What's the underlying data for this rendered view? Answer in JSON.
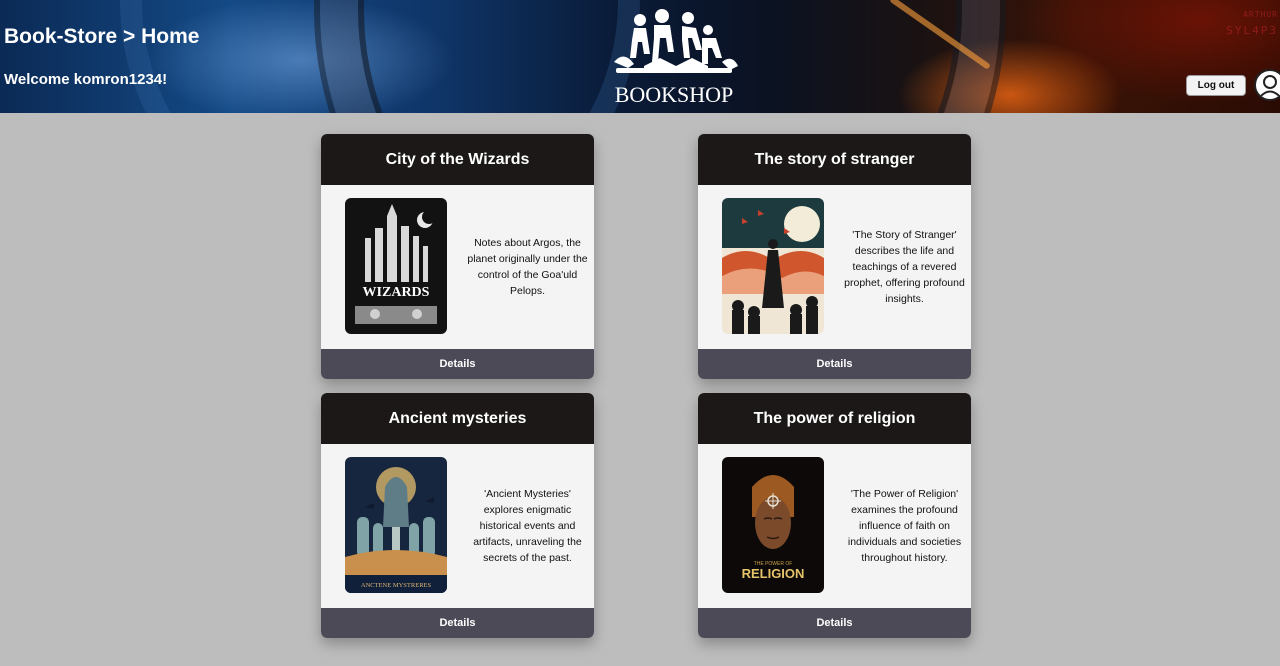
{
  "header": {
    "breadcrumb": "Book-Store > Home",
    "welcome": "Welcome komron1234!",
    "logo_text": "BOOKSHOP",
    "logout_label": "Log out",
    "corner_line1": "ARTHUR",
    "corner_line2": "SYL4P3"
  },
  "books": [
    {
      "title": "City of the Wizards",
      "cover_text": "WIZARDS",
      "description": "Notes about Argos, the planet originally under the control of the Goa'uld Pelops.",
      "details_label": "Details"
    },
    {
      "title": "The story of stranger",
      "description": "'The Story of Stranger' describes the life and teachings of a revered prophet, offering profound insights.",
      "details_label": "Details"
    },
    {
      "title": "Ancient mysteries",
      "cover_text": "ANCTENE MYSTRERES",
      "description": "'Ancient Mysteries' explores enigmatic historical events and artifacts, unraveling the secrets of the past.",
      "details_label": "Details"
    },
    {
      "title": "The power of religion",
      "cover_text_small": "THE POWER OF",
      "cover_text": "RELIGION",
      "description": "'The Power of Religion' examines the profound influence of faith on individuals and societies throughout history.",
      "details_label": "Details"
    }
  ],
  "colors": {
    "page_bg": "#bdbdbd",
    "card_title_bg": "#1b1817",
    "details_bg": "#4b4a56",
    "card_body_bg": "#f4f4f4"
  },
  "icons": [
    "bookshop-logo-icon",
    "user-avatar-icon"
  ]
}
